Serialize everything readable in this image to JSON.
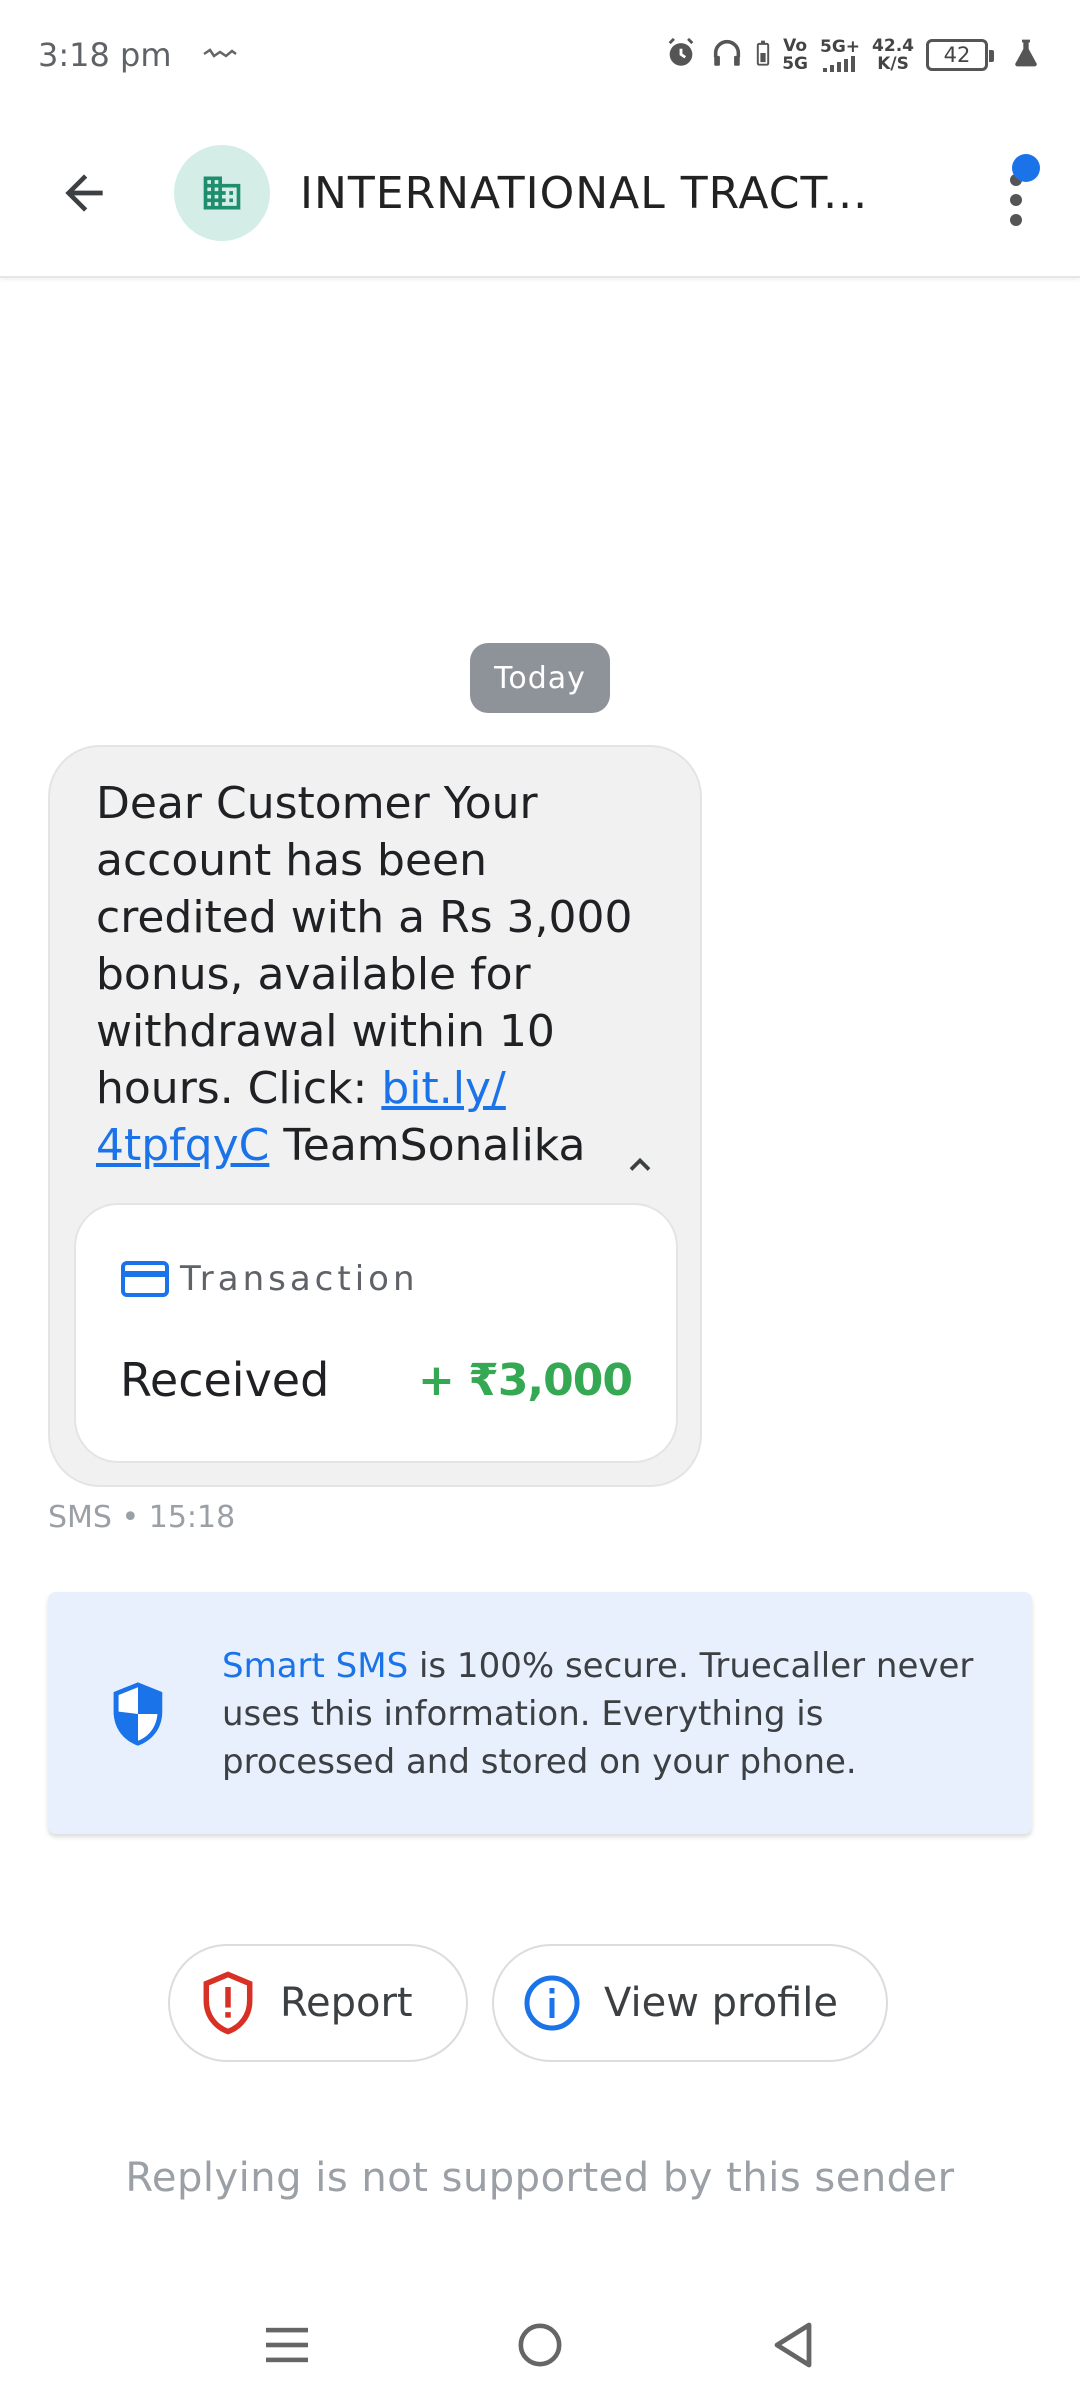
{
  "status_bar": {
    "time": "3:18 pm",
    "network_label_top": "Vo",
    "network_label_bottom": "5G",
    "signal_label": "5G+",
    "speed_value": "42.4",
    "speed_unit": "K/S",
    "battery": "42"
  },
  "header": {
    "title": "INTERNATIONAL TRACT...",
    "avatar_icon": "building-icon",
    "accent": "#1a73e8"
  },
  "conversation": {
    "date_chip": "Today",
    "message": {
      "text_before_link": "Dear Customer Your account has been credited with a Rs 3,000 bonus, available for withdrawal within 10 hours. Click: ",
      "link": "bit.ly/ 4tpfqyC",
      "text_after_link": " TeamSonalika"
    },
    "transaction": {
      "label": "Transaction",
      "status": "Received",
      "amount": "+ ₹3,000",
      "amount_color": "#34a853"
    },
    "meta": "SMS • 15:18"
  },
  "info_box": {
    "highlight": "Smart SMS",
    "text": " is 100% secure. Truecaller never uses this information. Everything is processed and stored on your phone."
  },
  "actions": {
    "report_label": "Report",
    "view_profile_label": "View profile"
  },
  "footer": {
    "reply_note": "Replying is not supported by this sender"
  }
}
